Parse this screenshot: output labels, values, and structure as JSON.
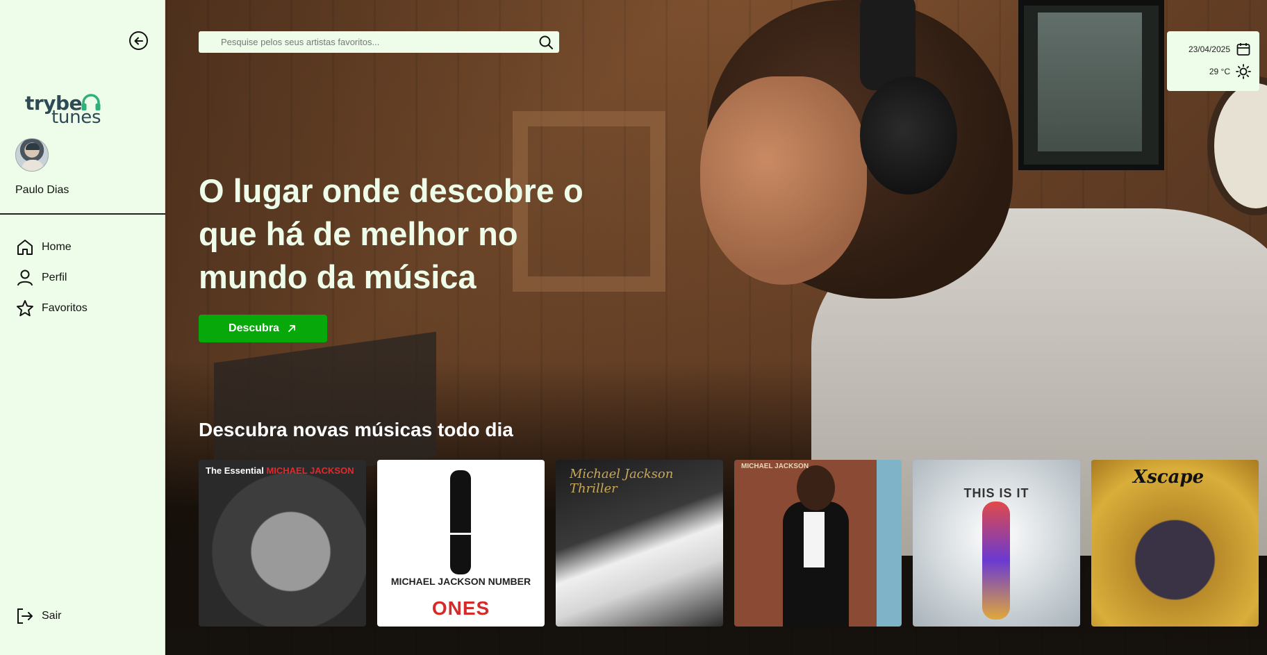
{
  "sidebar": {
    "logo_line1": "trybe",
    "logo_line2": "tunes",
    "user_name": "Paulo Dias",
    "nav": [
      {
        "label": "Home",
        "icon": "home-icon"
      },
      {
        "label": "Perfil",
        "icon": "user-icon"
      },
      {
        "label": "Favoritos",
        "icon": "star-icon"
      }
    ],
    "logout_label": "Sair"
  },
  "search": {
    "placeholder": "Pesquise pelos seus artistas favoritos...",
    "value": ""
  },
  "widget": {
    "date": "23/04/2025",
    "temperature": "29 °C"
  },
  "hero": {
    "title": "O lugar onde descobre o que há de melhor no mundo da música",
    "cta_label": "Descubra"
  },
  "section": {
    "title": "Descubra novas músicas todo dia"
  },
  "albums": [
    {
      "cover_text_1": "The Essential",
      "cover_text_2": "MICHAEL JACKSON"
    },
    {
      "cover_text_1": "MICHAEL JACKSON NUMBER",
      "cover_text_2": "ONES"
    },
    {
      "cover_text_1": "Michael Jackson Thriller"
    },
    {
      "cover_text_1": "MICHAEL JACKSON"
    },
    {
      "cover_text_1": "THIS IS IT"
    },
    {
      "cover_text_1": "Xscape"
    }
  ],
  "colors": {
    "sidebar_bg": "#eefde9",
    "accent": "#06a80a",
    "hero_text": "#eefde9"
  }
}
